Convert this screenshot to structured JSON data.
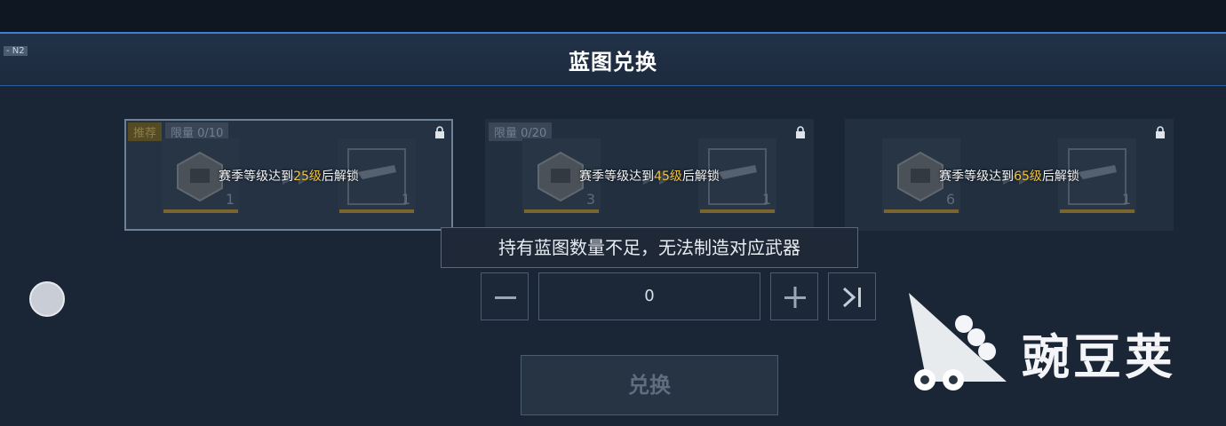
{
  "header": {
    "title": "蓝图兑换",
    "ghost_text": "- N2"
  },
  "cards": [
    {
      "selected": true,
      "badges": [
        "推荐",
        "限量 0/10"
      ],
      "unlock_prefix": "赛季等级达到",
      "unlock_level": "25级",
      "unlock_suffix": "后解锁",
      "input_qty": "1",
      "output_qty": "1"
    },
    {
      "selected": false,
      "badges": [
        "限量 0/20"
      ],
      "unlock_prefix": "赛季等级达到",
      "unlock_level": "45级",
      "unlock_suffix": "后解锁",
      "input_qty": "3",
      "output_qty": "1"
    },
    {
      "selected": false,
      "badges": [],
      "unlock_prefix": "赛季等级达到",
      "unlock_level": "65级",
      "unlock_suffix": "后解锁",
      "input_qty": "6",
      "output_qty": "1"
    }
  ],
  "tooltip": "持有蓝图数量不足，无法制造对应武器",
  "stepper": {
    "value": "0",
    "icons": [
      "minus-icon",
      "plus-icon",
      "max-icon"
    ]
  },
  "exchange_button": "兑换",
  "watermark": "豌豆荚",
  "colors": {
    "accent_blue": "#3f7fd0",
    "level_gold": "#f0c23c",
    "background": "#1a2535"
  }
}
